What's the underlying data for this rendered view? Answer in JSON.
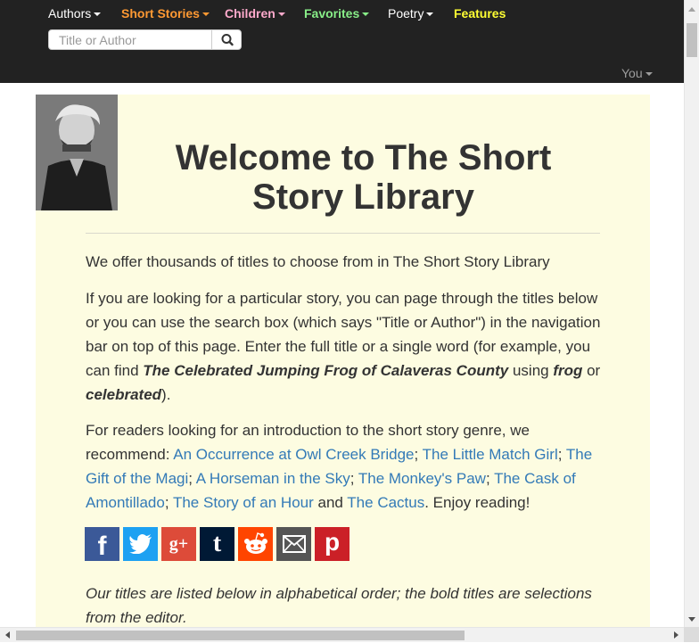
{
  "nav": {
    "items": [
      {
        "label": "Authors",
        "color": "#ffffff"
      },
      {
        "label": "Short Stories",
        "color": "#ff9933"
      },
      {
        "label": "Children",
        "color": "#ffaacc"
      },
      {
        "label": "Favorites",
        "color": "#88ee88"
      },
      {
        "label": "Poetry",
        "color": "#ffffff"
      },
      {
        "label": "Features",
        "color": "#ffff33"
      }
    ],
    "search_placeholder": "Title or Author",
    "user_menu": "You"
  },
  "main": {
    "title": "Welcome to The Short Story Library",
    "intro": "We offer thousands of titles to choose from in The Short Story Library",
    "search_help": {
      "text1": "If you are looking for a particular story, you can page through the titles below or you can use the search box (which says \"Title or Author\") in the navigation bar on top of this page. Enter the full title or a single word (for example, you can find ",
      "example_title": "The Celebrated Jumping Frog of Calaveras County",
      "text2": " using ",
      "word1": "frog",
      "text3": " or ",
      "word2": "celebrated",
      "text4": ")."
    },
    "recommend": {
      "text1": "For readers looking for an introduction to the short story genre, we recommend: ",
      "links": [
        "An Occurrence at Owl Creek Bridge",
        "The Little Match Girl",
        "The Gift of the Magi",
        "A Horseman in the Sky",
        "The Monkey's Paw",
        "The Cask of Amontillado",
        "The Story of an Hour",
        "The Cactus"
      ],
      "sep": "; ",
      "and": " and ",
      "ending": ". Enjoy reading!"
    },
    "share": [
      {
        "icon": "facebook-icon",
        "glyph": "f",
        "color": "#3b5998"
      },
      {
        "icon": "twitter-icon",
        "glyph": "",
        "color": "#1da1f2"
      },
      {
        "icon": "google-plus-icon",
        "glyph": "g+",
        "color": "#dd4b39"
      },
      {
        "icon": "tumblr-icon",
        "glyph": "t",
        "color": "#001935"
      },
      {
        "icon": "reddit-icon",
        "glyph": "",
        "color": "#ff4500"
      },
      {
        "icon": "email-icon",
        "glyph": "",
        "color": "#555555"
      },
      {
        "icon": "pinterest-icon",
        "glyph": "p",
        "color": "#cb2027"
      }
    ],
    "order_note": "Our titles are listed below in alphabetical order; the bold titles are selections from the editor."
  }
}
